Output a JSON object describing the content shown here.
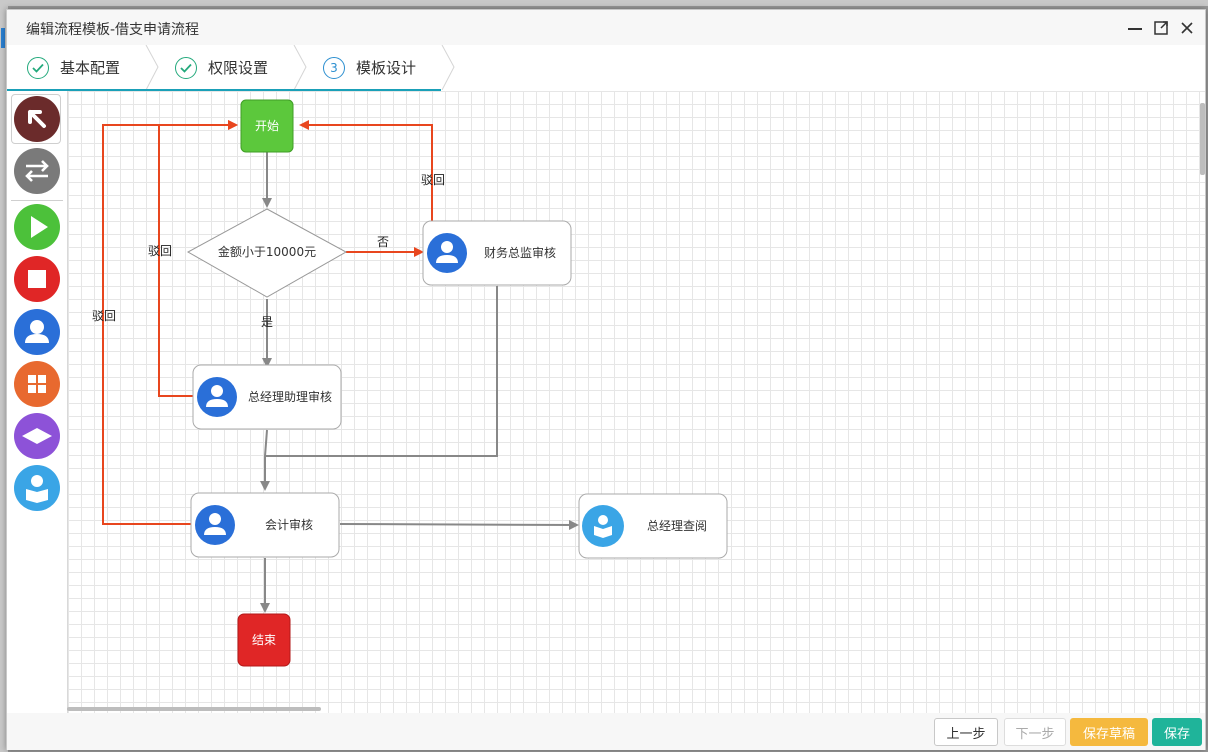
{
  "window": {
    "title": "编辑流程模板-借支申请流程"
  },
  "steps": [
    {
      "label": "基本配置",
      "state": "done"
    },
    {
      "label": "权限设置",
      "state": "done"
    },
    {
      "label": "模板设计",
      "state": "current",
      "number": "3"
    }
  ],
  "toolbar": {
    "tools": [
      {
        "name": "select",
        "icon": "arrow-select-icon",
        "color": "#6b2b2b"
      },
      {
        "name": "connector",
        "icon": "swap-arrows-icon",
        "color": "#7a7a7a"
      },
      {
        "name": "start",
        "icon": "play-icon",
        "color": "#4cc13a"
      },
      {
        "name": "end",
        "icon": "stop-icon",
        "color": "#e02626"
      },
      {
        "name": "task",
        "icon": "user-icon",
        "color": "#2a6fd8"
      },
      {
        "name": "subprocess",
        "icon": "grid-icon",
        "color": "#e8692f"
      },
      {
        "name": "decision",
        "icon": "diamond-icon",
        "color": "#8d52d8"
      },
      {
        "name": "cc",
        "icon": "reader-icon",
        "color": "#3aa5e6"
      }
    ]
  },
  "flow": {
    "nodes": {
      "start": "开始",
      "decision": "金额小于10000元",
      "finance": "财务总监审核",
      "assistant": "总经理助理审核",
      "accounting": "会计审核",
      "gm_cc": "总经理查阅",
      "end": "结束"
    },
    "edges": {
      "yes": "是",
      "no": "否",
      "reject1": "驳回",
      "reject2": "驳回",
      "reject3": "驳回"
    }
  },
  "footer": {
    "prev": "上一步",
    "next": "下一步",
    "save_draft": "保存草稿",
    "save": "保存"
  },
  "colors": {
    "accent": "#1aa0b8",
    "reject_line": "#e8461e",
    "flow_line": "#888888",
    "start": "#5cc83c",
    "end": "#e02626"
  }
}
